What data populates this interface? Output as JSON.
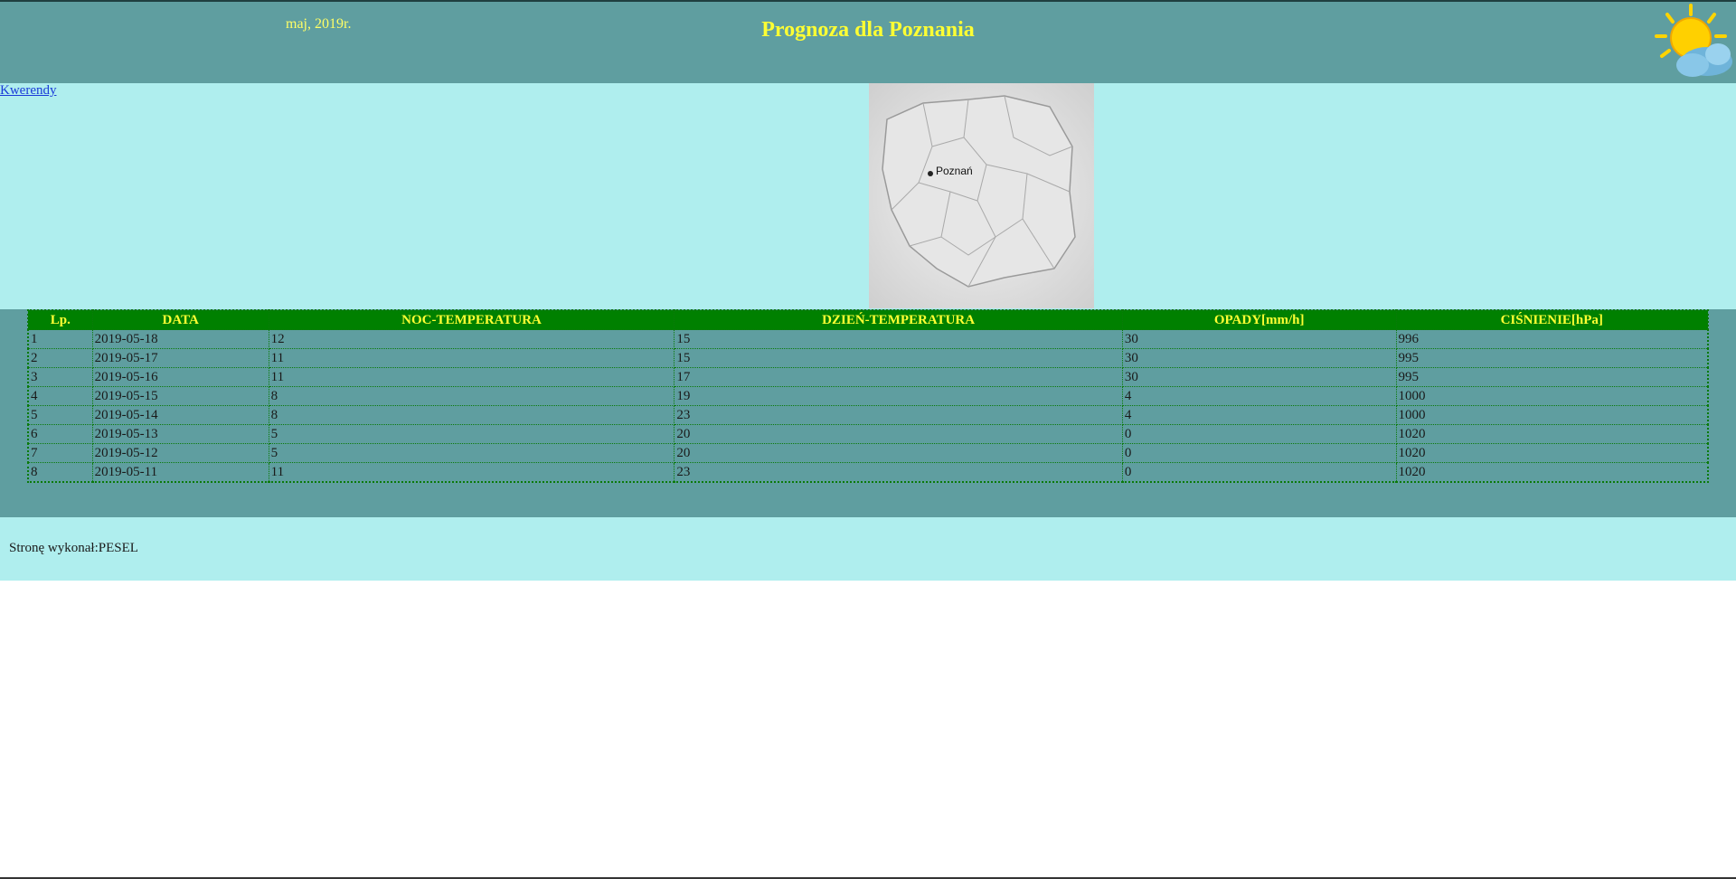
{
  "header": {
    "date": "maj, 2019r.",
    "title": "Prognoza dla Poznania",
    "weather_icon": "sun-behind-cloud-icon"
  },
  "nav": {
    "link_label": "Kwerendy",
    "map_label": "Poznań"
  },
  "table": {
    "columns": [
      "Lp.",
      "DATA",
      "NOC-TEMPERATURA",
      "DZIEŃ-TEMPERATURA",
      "OPADY[mm/h]",
      "CIŚNIENIE[hPa]"
    ],
    "rows": [
      [
        "1",
        "2019-05-18",
        "12",
        "15",
        "30",
        "996"
      ],
      [
        "2",
        "2019-05-17",
        "11",
        "15",
        "30",
        "995"
      ],
      [
        "3",
        "2019-05-16",
        "11",
        "17",
        "30",
        "995"
      ],
      [
        "4",
        "2019-05-15",
        "8",
        "19",
        "4",
        "1000"
      ],
      [
        "5",
        "2019-05-14",
        "8",
        "23",
        "4",
        "1000"
      ],
      [
        "6",
        "2019-05-13",
        "5",
        "20",
        "0",
        "1020"
      ],
      [
        "7",
        "2019-05-12",
        "5",
        "20",
        "0",
        "1020"
      ],
      [
        "8",
        "2019-05-11",
        "11",
        "23",
        "0",
        "1020"
      ]
    ]
  },
  "footer": {
    "text": "Stronę wykonał:PESEL"
  },
  "colors": {
    "header_bg": "#5f9ea0",
    "light_bg": "#afeeee",
    "table_header_bg": "#008000",
    "title_yellow": "#ffff33",
    "link_blue": "#1a3ad8"
  }
}
